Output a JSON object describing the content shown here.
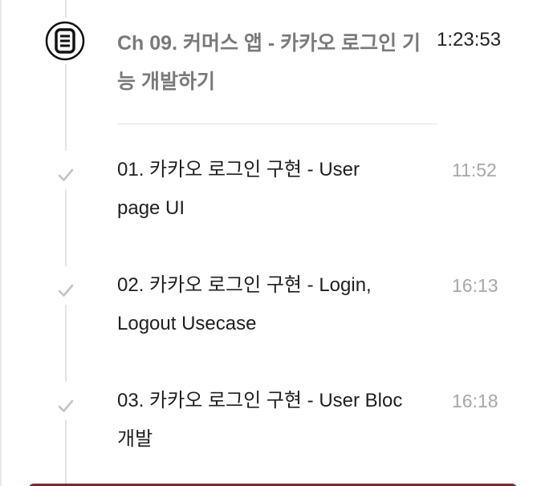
{
  "chapter": {
    "icon": "document-list-icon",
    "title": "Ch 09. 커머스 앱 - 카카오 로그인 기능 개발하기",
    "duration": "1:23:53"
  },
  "lessons": [
    {
      "title": "01. 카카오 로그인 구현 - User page UI",
      "duration": "11:52",
      "status_icon": "check-icon"
    },
    {
      "title": "02. 카카오 로그인 구현 - Login, Logout Usecase",
      "duration": "16:13",
      "status_icon": "check-icon"
    },
    {
      "title": "03. 카카오 로그인 구현 - User Bloc 개발",
      "duration": "16:18",
      "status_icon": "check-icon"
    }
  ],
  "colors": {
    "check": "#c4c4c4",
    "chapter_title": "#7a7a7a",
    "lesson_duration": "#a7a7a7",
    "accent_bar": "#8c1f2c"
  }
}
